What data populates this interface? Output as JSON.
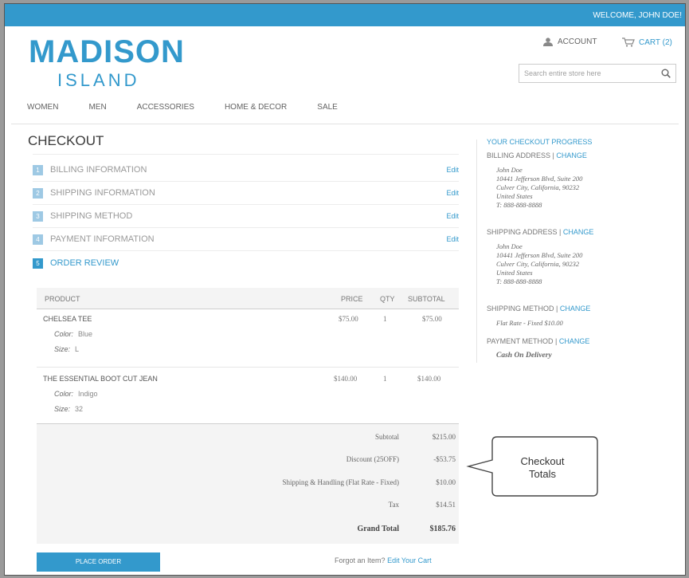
{
  "topbar": {
    "welcome": "WELCOME, JOHN DOE!"
  },
  "logo": {
    "line1": "MADISON",
    "line2": "ISLAND"
  },
  "header": {
    "account": "ACCOUNT",
    "cart": "CART (2)",
    "search_placeholder": "Search entire store here"
  },
  "nav": [
    "WOMEN",
    "MEN",
    "ACCESSORIES",
    "HOME & DECOR",
    "SALE"
  ],
  "page_title": "CHECKOUT",
  "steps": [
    {
      "num": "1",
      "label": "BILLING INFORMATION",
      "edit": "Edit"
    },
    {
      "num": "2",
      "label": "SHIPPING INFORMATION",
      "edit": "Edit"
    },
    {
      "num": "3",
      "label": "SHIPPING METHOD",
      "edit": "Edit"
    },
    {
      "num": "4",
      "label": "PAYMENT INFORMATION",
      "edit": "Edit"
    },
    {
      "num": "5",
      "label": "ORDER REVIEW",
      "edit": ""
    }
  ],
  "table": {
    "headers": {
      "product": "PRODUCT",
      "price": "PRICE",
      "qty": "QTY",
      "subtotal": "SUBTOTAL"
    },
    "rows": [
      {
        "name": "CHELSEA TEE",
        "attr1_label": "Color:",
        "attr1_value": "Blue",
        "attr2_label": "Size:",
        "attr2_value": "L",
        "price": "$75.00",
        "qty": "1",
        "subtotal": "$75.00"
      },
      {
        "name": "THE ESSENTIAL BOOT CUT JEAN",
        "attr1_label": "Color:",
        "attr1_value": "Indigo",
        "attr2_label": "Size:",
        "attr2_value": "32",
        "price": "$140.00",
        "qty": "1",
        "subtotal": "$140.00"
      }
    ]
  },
  "totals": [
    {
      "label": "Subtotal",
      "value": "$215.00"
    },
    {
      "label": "Discount (25OFF)",
      "value": "-$53.75"
    },
    {
      "label": "Shipping & Handling (Flat Rate - Fixed)",
      "value": "$10.00"
    },
    {
      "label": "Tax",
      "value": "$14.51"
    },
    {
      "label": "Grand Total",
      "value": "$185.76"
    }
  ],
  "place_order": "PLACE ORDER",
  "forgot": {
    "text": "Forgot an Item?",
    "link": "Edit Your Cart"
  },
  "progress": {
    "title": "YOUR CHECKOUT PROGRESS",
    "change": "CHANGE",
    "billing_label": "BILLING ADDRESS",
    "billing": [
      "John Doe",
      "10441 Jefferson Blvd, Suite 200",
      "Culver City, California, 90232",
      "United States",
      "T: 888-888-8888"
    ],
    "shipping_label": "SHIPPING ADDRESS",
    "shipping": [
      "John Doe",
      "10441 Jefferson Blvd, Suite 200",
      "Culver City, California, 90232",
      "United States",
      "T: 888-888-8888"
    ],
    "method_label": "SHIPPING METHOD",
    "method": "Flat Rate - Fixed $10.00",
    "payment_label": "PAYMENT METHOD",
    "payment": "Cash On Delivery"
  },
  "callout": {
    "line1": "Checkout",
    "line2": "Totals"
  },
  "colors": {
    "accent": "#3399cc",
    "step_inactive": "#9ec9e4",
    "table_bg": "#f4f4f4"
  }
}
